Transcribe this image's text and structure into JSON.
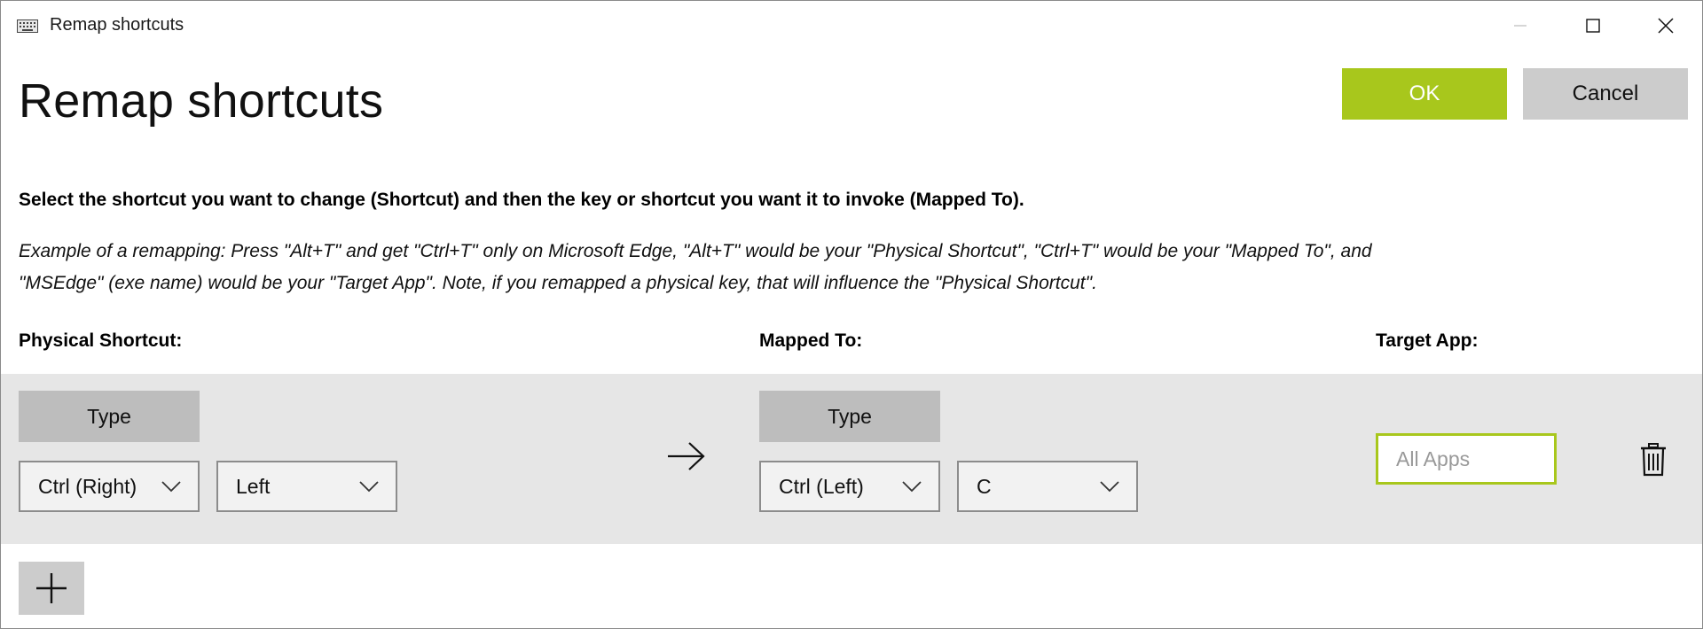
{
  "window": {
    "title": "Remap shortcuts"
  },
  "header": {
    "heading": "Remap shortcuts",
    "ok_label": "OK",
    "cancel_label": "Cancel"
  },
  "instruction": "Select the shortcut you want to change (Shortcut) and then the key or shortcut you want it to invoke (Mapped To).",
  "example_lines": [
    "Example of a remapping: Press \"Alt+T\" and get \"Ctrl+T\" only on Microsoft Edge, \"Alt+T\" would be your \"Physical Shortcut\", \"Ctrl+T\" would be your \"Mapped To\", and",
    "\"MSEdge\" (exe name) would be your \"Target App\". Note, if you remapped a physical key, that will influence the \"Physical Shortcut\"."
  ],
  "columns": {
    "physical": "Physical Shortcut:",
    "mapped": "Mapped To:",
    "target": "Target App:"
  },
  "row": {
    "physical_type_label": "Type",
    "physical_keys": [
      "Ctrl (Right)",
      "Left"
    ],
    "mapped_type_label": "Type",
    "mapped_keys": [
      "Ctrl (Left)",
      "C"
    ],
    "target_placeholder": "All Apps",
    "target_value": ""
  },
  "icons": {
    "app": "keyboard-icon",
    "minimize": "minimize-icon",
    "maximize": "maximize-icon",
    "close": "close-icon",
    "arrow": "arrow-right-icon",
    "chevron": "chevron-down-icon",
    "delete": "trash-icon",
    "add": "plus-icon"
  },
  "colors": {
    "accent": "#a8c71c",
    "row_bg": "#e6e6e6",
    "type_button": "#bdbdbd",
    "cancel_button": "#cccccc"
  }
}
